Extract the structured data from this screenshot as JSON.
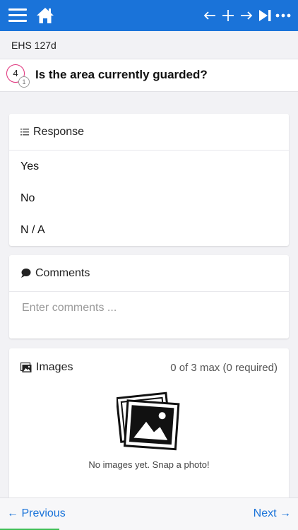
{
  "colors": {
    "brand": "#1a73d9",
    "question_ring": "#e0307a",
    "progress": "#3dbf55"
  },
  "topbar": {
    "icons": [
      "menu-icon",
      "home-icon",
      "arrow-left-icon",
      "plus-icon",
      "arrow-right-icon",
      "skip-to-end-icon",
      "more-icon"
    ]
  },
  "form": {
    "name": "EHS 127d"
  },
  "question": {
    "number": "4",
    "sub_number": "1",
    "text": "Is the area currently guarded?"
  },
  "response": {
    "title": "Response",
    "options": [
      "Yes",
      "No",
      "N / A"
    ]
  },
  "comments": {
    "title": "Comments",
    "placeholder": "Enter comments ..."
  },
  "images": {
    "title": "Images",
    "count": "0 of 3 max (0 required)",
    "empty_text": "No images yet. Snap a photo!"
  },
  "nav": {
    "previous": "← Previous",
    "next": "Next →"
  }
}
